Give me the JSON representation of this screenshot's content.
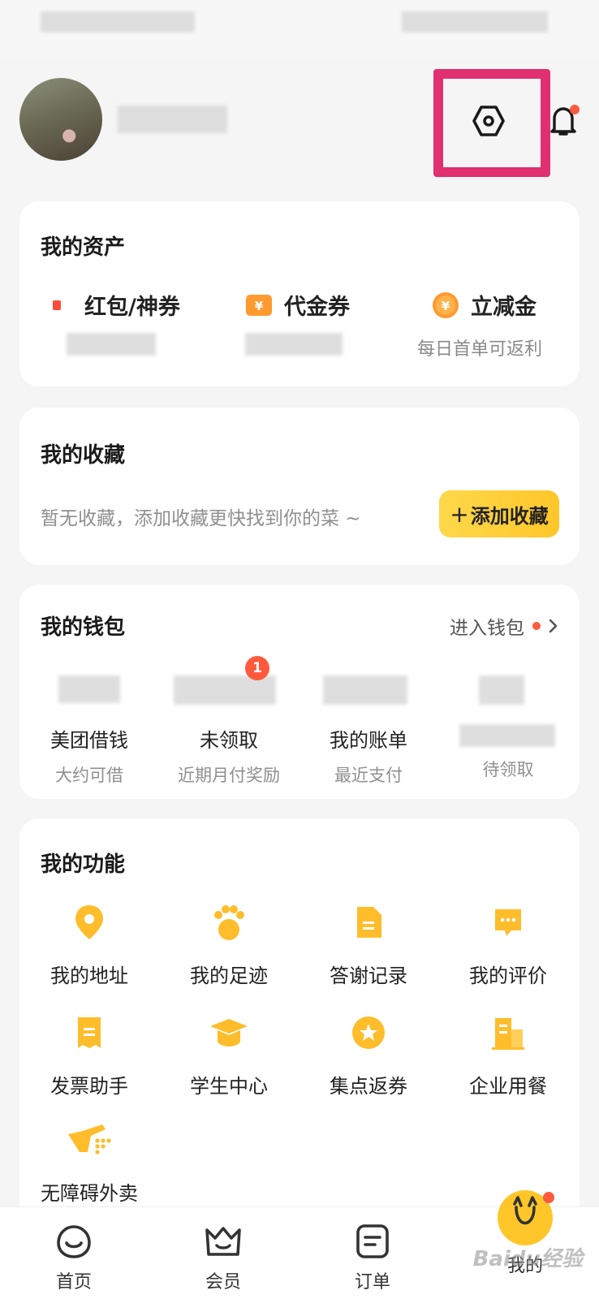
{
  "header": {
    "settings_icon": "settings-hexagon-icon",
    "notification_icon": "bell-icon"
  },
  "assets": {
    "title": "我的资产",
    "items": [
      {
        "label": "红包/神券",
        "icon": "red-packet-icon",
        "sub": ""
      },
      {
        "label": "代金券",
        "icon": "voucher-icon",
        "sub": ""
      },
      {
        "label": "立减金",
        "icon": "discount-coin-icon",
        "sub": "每日首单可返利"
      }
    ]
  },
  "favorites": {
    "title": "我的收藏",
    "hint": "暂无收藏，添加收藏更快找到你的菜 ~",
    "add_button_icon": "+",
    "add_button": "添加收藏"
  },
  "wallet": {
    "title": "我的钱包",
    "enter": "进入钱包",
    "items": [
      {
        "label": "美团借钱",
        "sub": "大约可借"
      },
      {
        "label": "未领取",
        "sub": "近期月付奖励",
        "badge": "1"
      },
      {
        "label": "我的账单",
        "sub": "最近支付"
      },
      {
        "label": "",
        "sub": "待领取"
      }
    ]
  },
  "functions": {
    "title": "我的功能",
    "items": [
      {
        "label": "我的地址",
        "icon": "location-pin-icon"
      },
      {
        "label": "我的足迹",
        "icon": "paw-print-icon"
      },
      {
        "label": "答谢记录",
        "icon": "document-icon"
      },
      {
        "label": "我的评价",
        "icon": "chat-bubble-icon"
      },
      {
        "label": "发票助手",
        "icon": "receipt-icon"
      },
      {
        "label": "学生中心",
        "icon": "graduation-cap-icon"
      },
      {
        "label": "集点返券",
        "icon": "star-coin-icon"
      },
      {
        "label": "企业用餐",
        "icon": "building-icon"
      },
      {
        "label": "无障碍外卖",
        "icon": "accessibility-hand-icon"
      }
    ]
  },
  "tabbar": {
    "items": [
      {
        "label": "首页",
        "icon": "home-icon"
      },
      {
        "label": "会员",
        "icon": "member-crown-icon"
      },
      {
        "label": "订单",
        "icon": "order-list-icon"
      },
      {
        "label": "我的",
        "icon": "mine-mascot-icon"
      }
    ]
  },
  "watermark": "Baidu经验",
  "colors": {
    "accent_yellow": "#ffc62a",
    "highlight_pink": "#e0306f",
    "badge_red": "#ff5a3d",
    "icon_yellow": "#ffbd2b"
  }
}
